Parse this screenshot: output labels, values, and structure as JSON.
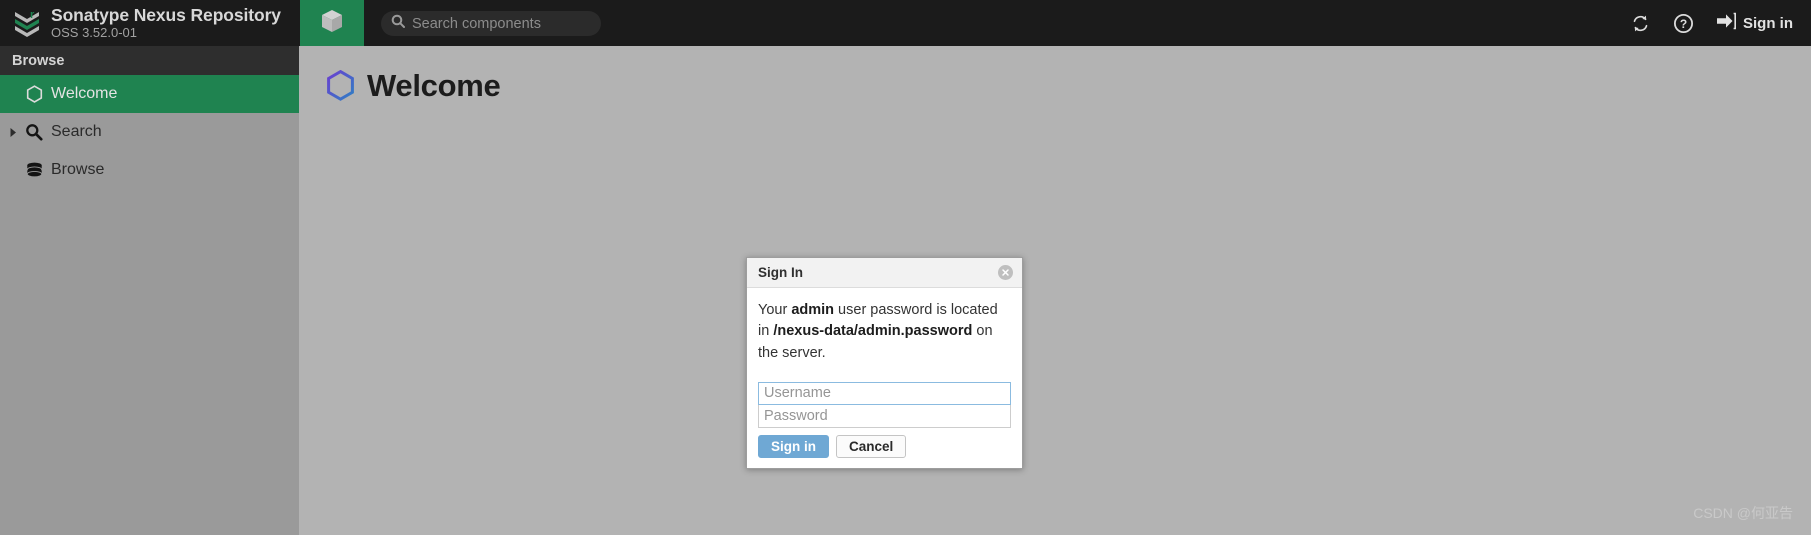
{
  "topbar": {
    "brand_title": "Sonatype Nexus Repository",
    "brand_subtitle": "OSS 3.52.0-01",
    "logo_icon": "sonatype-chevron-logo",
    "cube_icon": "cube-icon",
    "search": {
      "icon": "search-icon",
      "placeholder": "Search components",
      "value": ""
    },
    "refresh_icon": "refresh-icon",
    "help_icon": "help-circle-icon",
    "signin_icon": "sign-in-arrow-icon",
    "signin_label": "Sign in"
  },
  "sidebar": {
    "header": "Browse",
    "items": [
      {
        "label": "Welcome",
        "icon": "hexagon-icon",
        "active": true,
        "expandable": false
      },
      {
        "label": "Search",
        "icon": "search-icon",
        "active": false,
        "expandable": true
      },
      {
        "label": "Browse",
        "icon": "database-icon",
        "active": false,
        "expandable": false
      }
    ]
  },
  "main": {
    "page_icon": "hexagon-gradient-icon",
    "page_title": "Welcome"
  },
  "dialog": {
    "title": "Sign In",
    "close_icon": "close-circle-icon",
    "message_parts": {
      "p1": "Your ",
      "b1": "admin",
      "p2": " user password is located in ",
      "b2": "/nexus-data/admin.password",
      "p3": " on the server."
    },
    "username": {
      "placeholder": "Username",
      "value": "",
      "focused": true
    },
    "password": {
      "placeholder": "Password",
      "value": "",
      "focused": false
    },
    "signin_button": "Sign in",
    "cancel_button": "Cancel"
  },
  "watermark": "CSDN @何亚告",
  "colors": {
    "topbar_bg": "#1b1b1b",
    "accent_green": "#1f8350",
    "sidebar_bg": "#9a9a9a",
    "main_bg": "#b3b3b3",
    "primary_button": "#6fa8d4",
    "focus_border": "#8bbbe0"
  }
}
